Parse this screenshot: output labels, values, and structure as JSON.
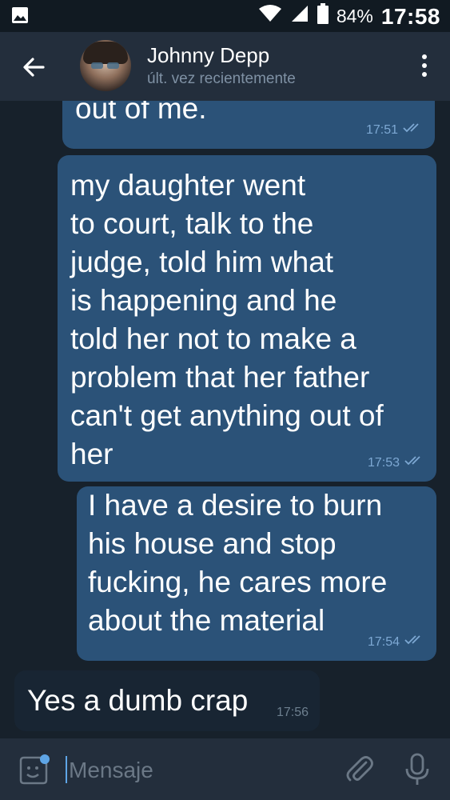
{
  "status_bar": {
    "battery_percent": "84%",
    "time": "17:58",
    "icons": [
      "image-notification-icon",
      "wifi-icon",
      "signal-icon",
      "battery-icon"
    ]
  },
  "header": {
    "contact_name": "Johnny Depp",
    "last_seen": "últ. vez recientemente",
    "icons": [
      "back-arrow-icon",
      "avatar",
      "more-vert-icon"
    ]
  },
  "messages": [
    {
      "direction": "outgoing",
      "text": "out of me.",
      "time": "17:51",
      "status": "read"
    },
    {
      "direction": "outgoing",
      "text": "my daughter went\nto court, talk to the\njudge, told him what\nis happening and he\ntold her not to make a\nproblem that her father\ncan't get anything out of\nher",
      "time": "17:53",
      "status": "read"
    },
    {
      "direction": "outgoing",
      "text": "I have a desire to burn\nhis house and stop\nfucking, he cares more\nabout the material",
      "time": "17:54",
      "status": "read"
    },
    {
      "direction": "incoming",
      "text": "Yes a dumb crap",
      "time": "17:56"
    }
  ],
  "input": {
    "placeholder": "Mensaje",
    "icons": [
      "sticker-icon",
      "attach-icon",
      "mic-icon"
    ]
  },
  "colors": {
    "background": "#17212b",
    "header": "#232e3c",
    "outgoing_bubble": "#2b5278",
    "incoming_bubble": "#182533",
    "accent": "#5ea5e6"
  }
}
